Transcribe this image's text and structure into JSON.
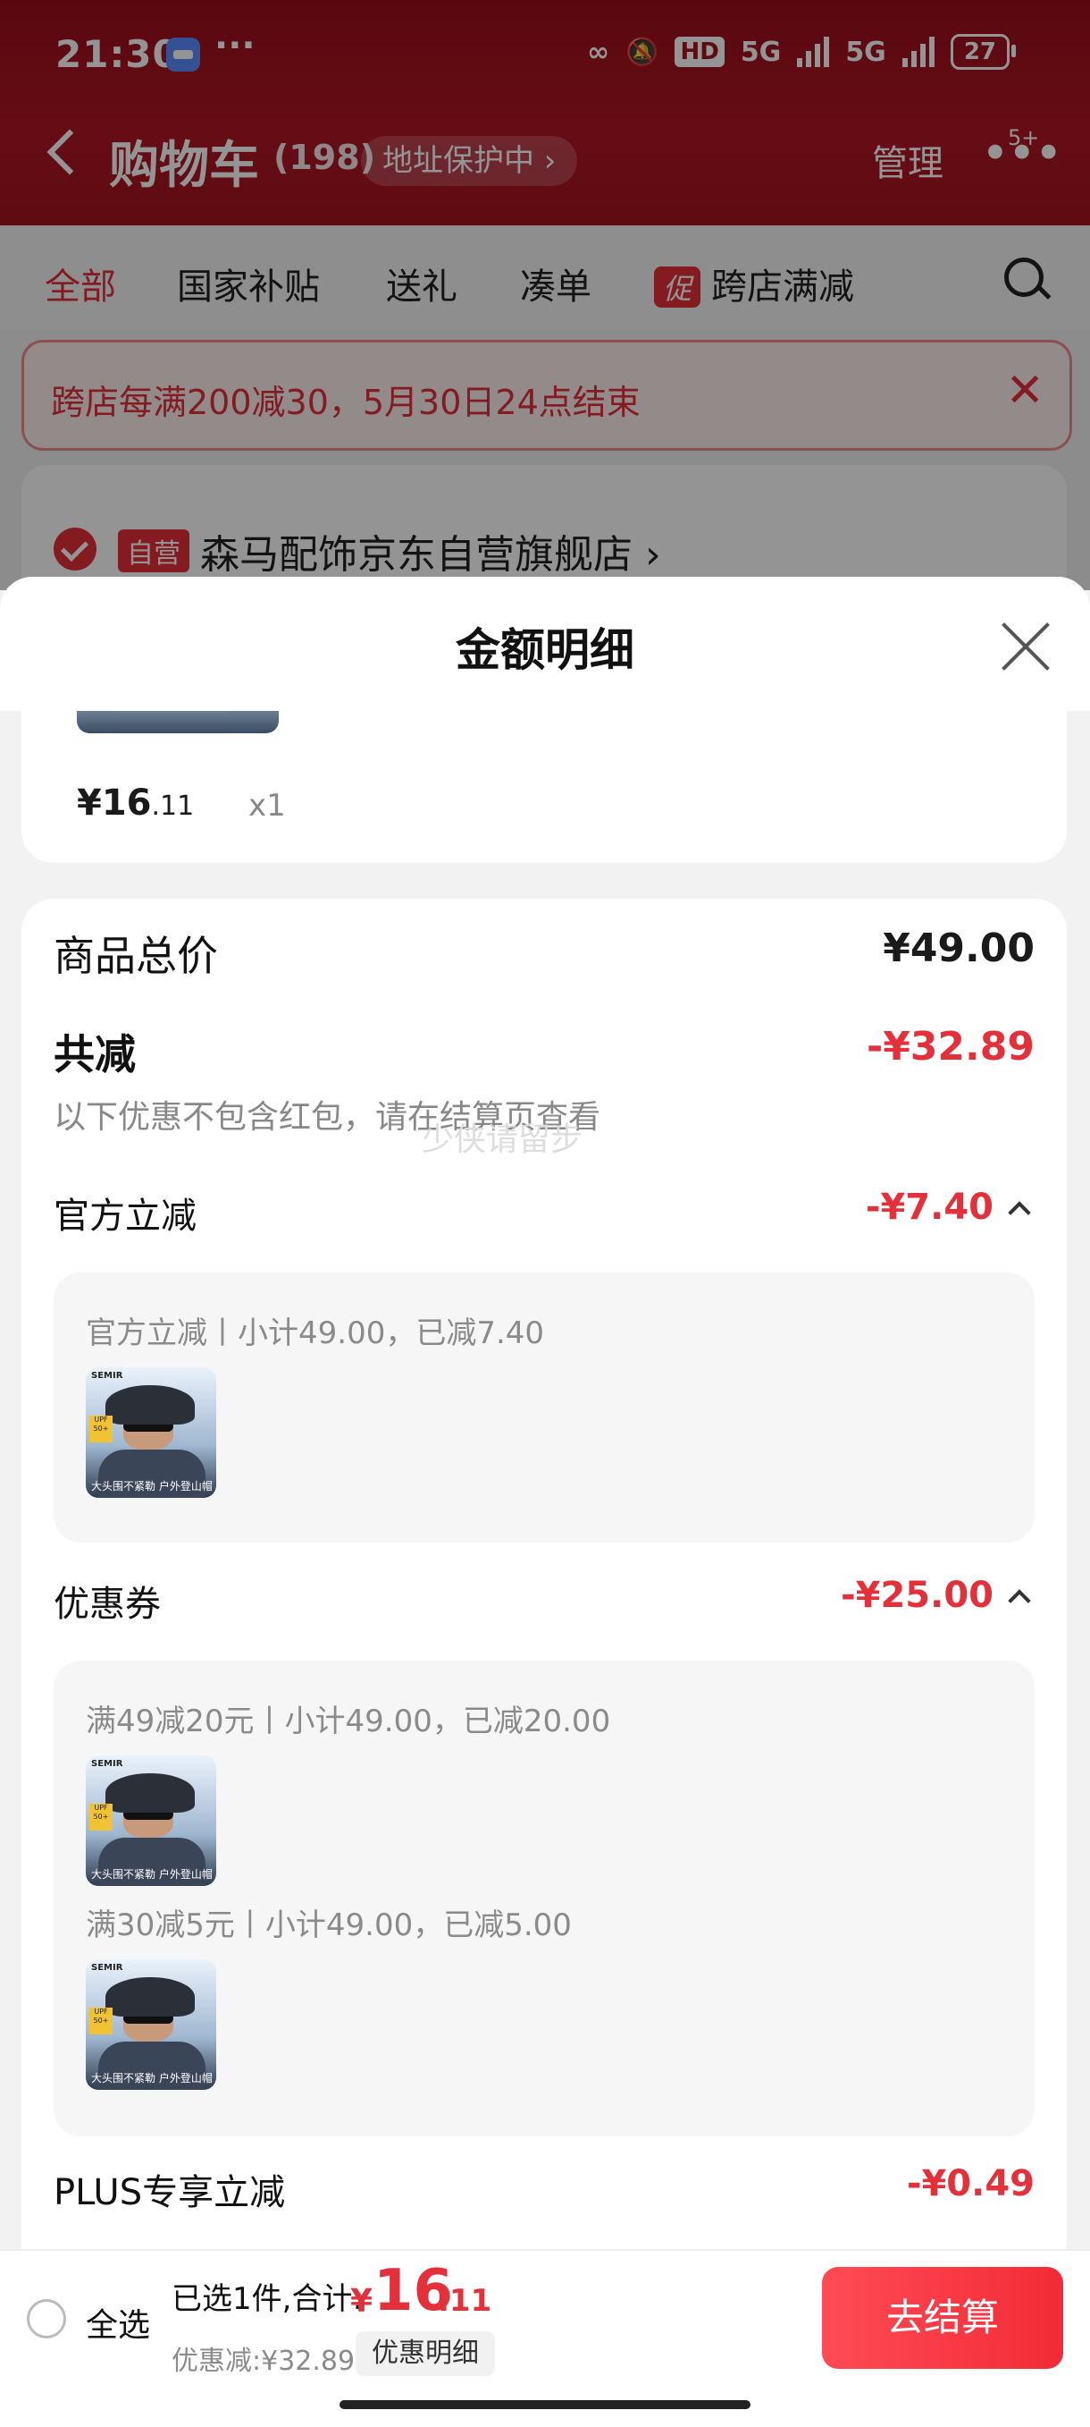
{
  "status_bar": {
    "time": "21:30",
    "more": "···",
    "hd": "HD",
    "net1": "5G",
    "net2": "5G",
    "battery": "27"
  },
  "header": {
    "title": "购物车",
    "count": "(198)",
    "address_pill": "地址保护中 ›",
    "manage": "管理",
    "more": "•••",
    "more_badge": "5+"
  },
  "tabs": {
    "items": [
      "全部",
      "国家补贴",
      "送礼",
      "凑单"
    ],
    "promo_tag": "促",
    "promo_label": "跨店满减",
    "active_index": 0
  },
  "notice": {
    "text": "跨店每满200减30，5月30日24点结束",
    "close": "✕"
  },
  "store": {
    "self_tag": "自营",
    "name": "森马配饰京东自营旗舰店 ›"
  },
  "sheet": {
    "title": "金额明细",
    "item": {
      "price_int": "¥16",
      "price_dec": ".11",
      "qty": "x1"
    },
    "total_label": "商品总价",
    "total_value": "¥49.00",
    "discount_label": "共减",
    "discount_value": "-¥32.89",
    "discount_hint": "以下优惠不包含红包，请在结算页查看",
    "watermark": "少侠请留步",
    "official": {
      "label": "官方立减",
      "value": "-¥7.40",
      "line": "官方立减丨小计49.00，已减7.40"
    },
    "coupon": {
      "label": "优惠券",
      "value": "-¥25.00",
      "line1": "满49减20元丨小计49.00，已减20.00",
      "line2": "满30减5元丨小计49.00，已减5.00"
    },
    "plus": {
      "label": "PLUS专享立减",
      "value": "-¥0.49"
    },
    "thumb": {
      "brand": "SEMIR",
      "upf": "UPF 50+",
      "caption": "大头围不紧勒 户外登山帽"
    }
  },
  "checkout": {
    "select_all": "全选",
    "summary": "已选1件,合计:",
    "total_yen": "¥",
    "total_int": "16",
    "total_dec": ".11",
    "saved": "优惠减:¥32.89",
    "detail_button": "优惠明细",
    "pay_button": "去结算"
  },
  "colors": {
    "brand_red": "#e4303a",
    "header_red": "#a4131f"
  }
}
